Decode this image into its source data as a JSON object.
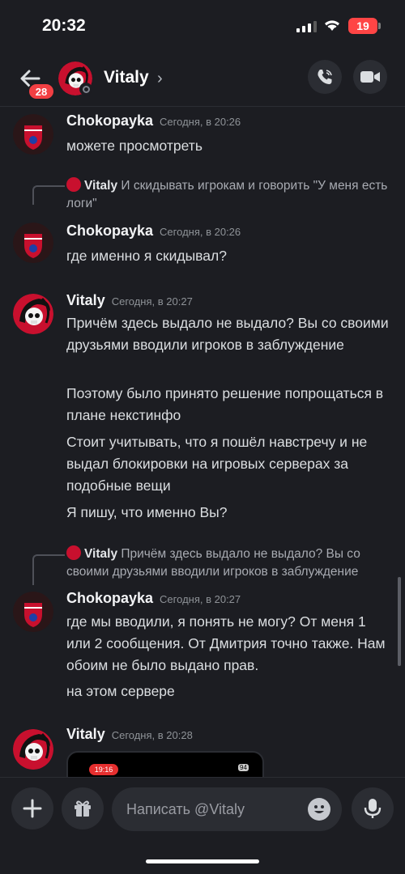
{
  "status_bar": {
    "time": "20:32",
    "battery": "19"
  },
  "header": {
    "badge_count": "28",
    "contact_name": "Vitaly",
    "chevron": "›"
  },
  "messages": [
    {
      "author": "Chokopayka",
      "time": "Сегодня, в 20:26",
      "lines": [
        "можете просмотреть"
      ]
    },
    {
      "reply": {
        "author": "Vitaly",
        "text": "И скидывать игрокам и говорить \"У меня есть логи\""
      },
      "author": "Chokopayka",
      "time": "Сегодня, в 20:26",
      "lines": [
        "где именно я скидывал?"
      ]
    },
    {
      "author": "Vitaly",
      "time": "Сегодня, в 20:27",
      "paragraphs": [
        "Причём здесь выдало не выдало? Вы со своими друзьями вводили игроков в заблуждение",
        "Поэтому было принято решение попрощаться в плане некстинфо",
        "Стоит учитывать, что я пошёл навстречу и не выдал блокировки на игровых серверах за подобные вещи",
        "Я пишу, что именно Вы?"
      ]
    },
    {
      "reply": {
        "author": "Vitaly",
        "text": "Причём здесь выдало не выдало? Вы со своими друзьями вводили игроков в заблуждение"
      },
      "author": "Chokopayka",
      "time": "Сегодня, в 20:27",
      "paragraphs": [
        "где мы вводили, я понять не могу? От меня 1 или 2 сообщения. От Дмитрия точно также. Нам обоим не было выдано прав.",
        "на этом сервере"
      ]
    },
    {
      "author": "Vitaly",
      "time": "Сегодня, в 20:28",
      "thumb_time": "19:16",
      "thumb_battery": "94"
    }
  ],
  "composer": {
    "placeholder": "Написать @Vitaly"
  },
  "colors": {
    "background": "#1c1d22",
    "badge": "#f23f43",
    "avatar_red": "#c8102e"
  }
}
